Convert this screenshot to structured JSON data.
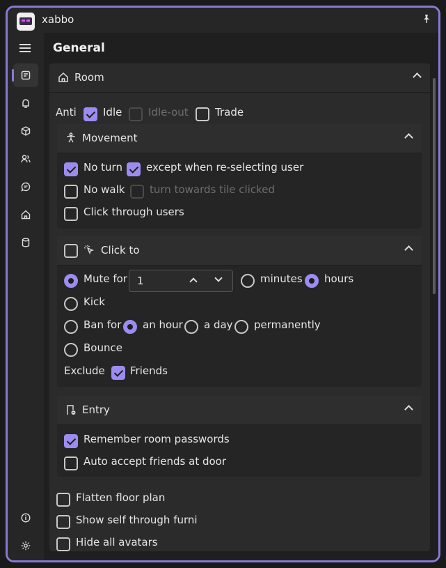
{
  "app": {
    "title": "xabbo"
  },
  "page": {
    "title": "General"
  },
  "room": {
    "title": "Room",
    "anti_label": "Anti",
    "idle": {
      "label": "Idle",
      "checked": true
    },
    "idle_out": {
      "label": "Idle-out",
      "checked": false,
      "disabled": true
    },
    "trade": {
      "label": "Trade",
      "checked": false
    }
  },
  "movement": {
    "title": "Movement",
    "no_turn": {
      "label": "No turn",
      "checked": true
    },
    "except_reselect": {
      "label": "except when re-selecting user",
      "checked": true
    },
    "no_walk": {
      "label": "No walk",
      "checked": false
    },
    "turn_towards": {
      "label": "turn towards tile clicked",
      "checked": false,
      "disabled": true
    },
    "click_through": {
      "label": "Click through users",
      "checked": false
    }
  },
  "click_to": {
    "title": "Click to",
    "enabled": false,
    "mute_for": {
      "label": "Mute for",
      "selected": true,
      "value": "1"
    },
    "unit_minutes": {
      "label": "minutes",
      "selected": false
    },
    "unit_hours": {
      "label": "hours",
      "selected": true
    },
    "kick": {
      "label": "Kick",
      "selected": false
    },
    "ban_for": {
      "label": "Ban for",
      "selected": false
    },
    "ban_hour": {
      "label": "an hour",
      "selected": true
    },
    "ban_day": {
      "label": "a day",
      "selected": false
    },
    "ban_perm": {
      "label": "permanently",
      "selected": false
    },
    "bounce": {
      "label": "Bounce",
      "selected": false
    },
    "exclude_label": "Exclude",
    "friends": {
      "label": "Friends",
      "checked": true
    }
  },
  "entry": {
    "title": "Entry",
    "remember_passwords": {
      "label": "Remember room passwords",
      "checked": true
    },
    "auto_accept": {
      "label": "Auto accept friends at door",
      "checked": false
    }
  },
  "misc": {
    "flatten": {
      "label": "Flatten floor plan",
      "checked": false
    },
    "show_self": {
      "label": "Show self through furni",
      "checked": false
    },
    "hide_avatars": {
      "label": "Hide all avatars",
      "checked": false
    }
  },
  "colors": {
    "accent": "#9d8cf0",
    "border": "#8a78d6",
    "bg": "#1f1f1f",
    "card": "#2b2b2b"
  }
}
